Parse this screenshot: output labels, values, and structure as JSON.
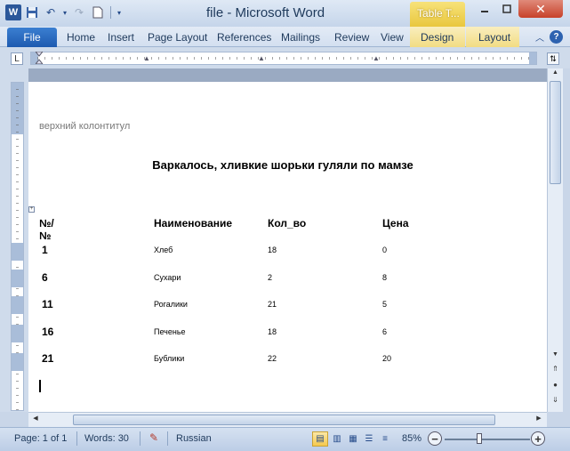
{
  "app": {
    "title": "file  -  Microsoft Word",
    "contextual_tab": "Table T...",
    "icon": "W"
  },
  "ribbon": {
    "tabs": {
      "file": "File",
      "home": "Home",
      "insert": "Insert",
      "page_layout": "Page Layout",
      "references": "References",
      "mailings": "Mailings",
      "review": "Review",
      "view": "View",
      "design": "Design",
      "layout": "Layout"
    },
    "help_label": "?"
  },
  "document": {
    "header_text": "верхний колонтитул",
    "title": "Варкалось, хливкие шорьки гуляли по мамзе",
    "table": {
      "headers": [
        "№/№",
        "Наименование",
        "Кол_во",
        "Цена"
      ],
      "rows": [
        [
          "1",
          "Хлеб",
          "18",
          "0"
        ],
        [
          "6",
          "Сухари",
          "2",
          "8"
        ],
        [
          "11",
          "Рогалики",
          "21",
          "5"
        ],
        [
          "16",
          "Печенье",
          "18",
          "6"
        ],
        [
          "21",
          "Бублики",
          "22",
          "20"
        ]
      ]
    }
  },
  "statusbar": {
    "page": "Page: 1 of 1",
    "words": "Words: 30",
    "language": "Russian",
    "zoom": "85%"
  },
  "colors": {
    "file_tab": "#1e5ab0",
    "contextual_tab": "#e9c73d",
    "close_button": "#c7412a"
  }
}
